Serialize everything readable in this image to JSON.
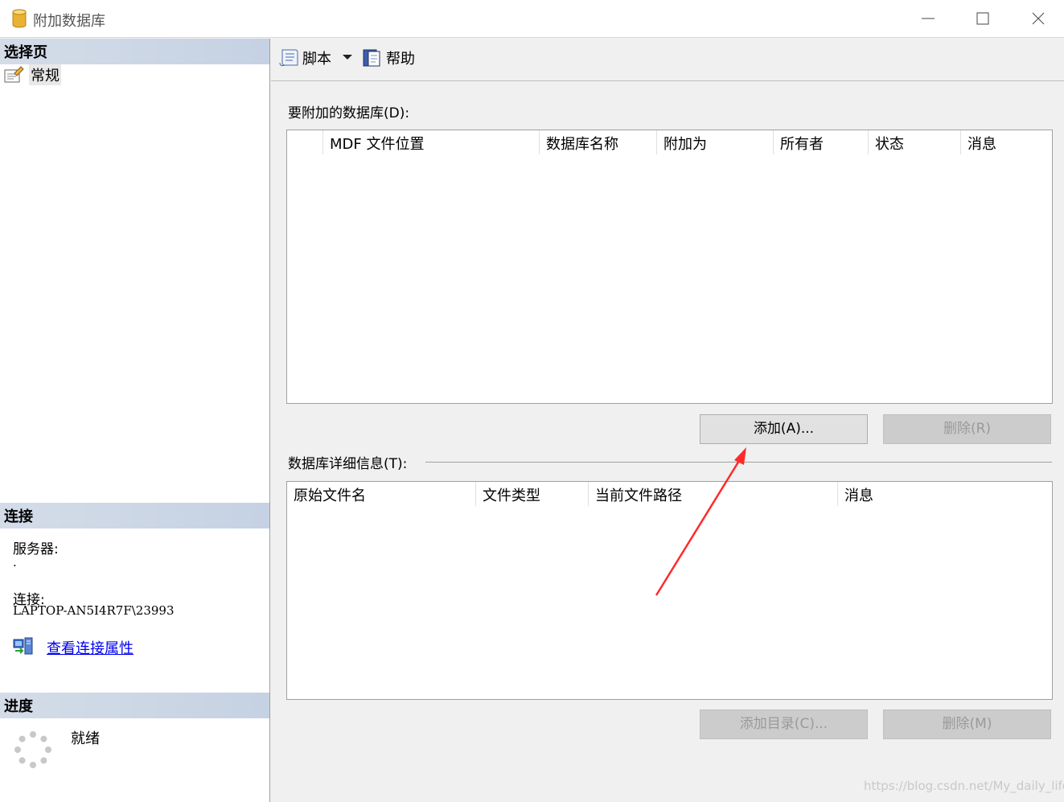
{
  "window": {
    "title": "附加数据库",
    "icons": {
      "app": "database-cylinder-icon",
      "minimize": "minimize-icon",
      "maximize": "maximize-icon",
      "close": "close-icon"
    }
  },
  "left": {
    "select_page": {
      "header": "选择页",
      "items": [
        {
          "label": "常规",
          "icon": "general-page-icon"
        }
      ]
    },
    "connection": {
      "header": "连接",
      "server_label": "服务器:",
      "server_value": ".",
      "connection_label": "连接:",
      "connection_value": "LAPTOP-AN5I4R7F\\23993",
      "view_properties_link": "查看连接属性"
    },
    "progress": {
      "header": "进度",
      "status": "就绪"
    }
  },
  "toolbar": {
    "script_label": "脚本",
    "help_label": "帮助"
  },
  "attach": {
    "label": "要附加的数据库(D):",
    "columns": [
      "",
      "MDF 文件位置",
      "数据库名称",
      "附加为",
      "所有者",
      "状态",
      "消息"
    ],
    "add_button": "添加(A)...",
    "remove_button": "删除(R)"
  },
  "details": {
    "label": "数据库详细信息(T):",
    "columns": [
      "原始文件名",
      "文件类型",
      "当前文件路径",
      "消息"
    ],
    "add_catalog_button": "添加目录(C)...",
    "remove_button": "删除(M)"
  },
  "watermark": "https://blog.csdn.net/My_daily_life",
  "colors": {
    "annotation_arrow": "#ff2a2a",
    "link": "#0000ee",
    "section_header": "#c5d2e3"
  }
}
